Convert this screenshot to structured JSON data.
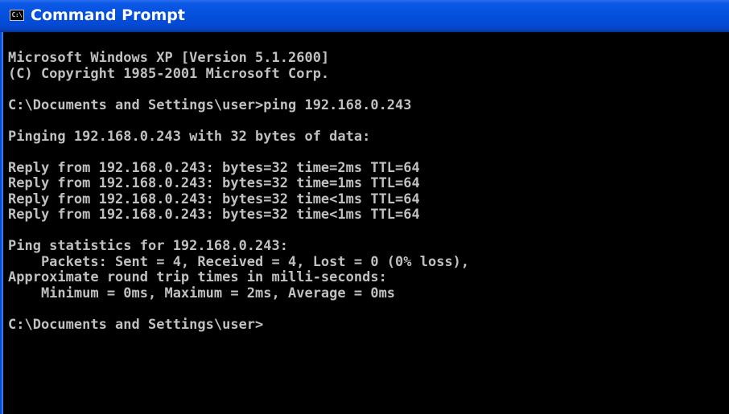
{
  "window": {
    "title": "Command Prompt",
    "icon": "console-icon",
    "icon_glyph": "C:\\",
    "colors": {
      "titlebar": "#0550dc",
      "console_bg": "#000000",
      "console_fg": "#c0c0c0"
    }
  },
  "console": {
    "lines": [
      "Microsoft Windows XP [Version 5.1.2600]",
      "(C) Copyright 1985-2001 Microsoft Corp.",
      "",
      "C:\\Documents and Settings\\user>ping 192.168.0.243",
      "",
      "Pinging 192.168.0.243 with 32 bytes of data:",
      "",
      "Reply from 192.168.0.243: bytes=32 time=2ms TTL=64",
      "Reply from 192.168.0.243: bytes=32 time=1ms TTL=64",
      "Reply from 192.168.0.243: bytes=32 time<1ms TTL=64",
      "Reply from 192.168.0.243: bytes=32 time<1ms TTL=64",
      "",
      "Ping statistics for 192.168.0.243:",
      "    Packets: Sent = 4, Received = 4, Lost = 0 (0% loss),",
      "Approximate round trip times in milli-seconds:",
      "    Minimum = 0ms, Maximum = 2ms, Average = 0ms",
      "",
      "C:\\Documents and Settings\\user>"
    ]
  }
}
